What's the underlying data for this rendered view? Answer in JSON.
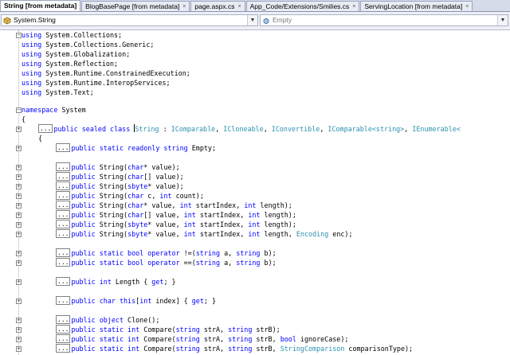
{
  "tabs": [
    {
      "label": "String [from metadata]",
      "active": true
    },
    {
      "label": "BlogBasePage [from metadata]",
      "active": false
    },
    {
      "label": "page.aspx.cs",
      "active": false
    },
    {
      "label": "App_Code/Extensions/Smilies.cs",
      "active": false
    },
    {
      "label": "ServingLocation [from metadata]",
      "active": false
    }
  ],
  "tab_close_glyph": "×",
  "navbar": {
    "type_combo": "System.String",
    "member_combo": "Empty",
    "combo_arrow": "▼"
  },
  "code": {
    "usings": [
      "System.Collections;",
      "System.Collections.Generic;",
      "System.Globalization;",
      "System.Reflection;",
      "System.Runtime.ConstrainedExecution;",
      "System.Runtime.InteropServices;",
      "System.Text;"
    ],
    "using_kw": "using",
    "namespace_kw": "namespace",
    "namespace_name": "System",
    "open_brace": "{",
    "collapsed_marker": "...",
    "class_decl": {
      "kw": "public sealed class",
      "name": "String",
      "colon": " : ",
      "bases": [
        "IComparable",
        "ICloneable",
        "IConvertible",
        "IComparable<string>",
        "IEnumerable<"
      ]
    }
  },
  "colors": {
    "keyword": "#0000ff",
    "type": "#2b91af",
    "text": "#000000"
  },
  "icons": {
    "type_combo_icon": "class-icon",
    "member_combo_icon": "field-icon",
    "outline_collapse": "outline-minus-icon",
    "outline_expand": "outline-plus-icon"
  }
}
